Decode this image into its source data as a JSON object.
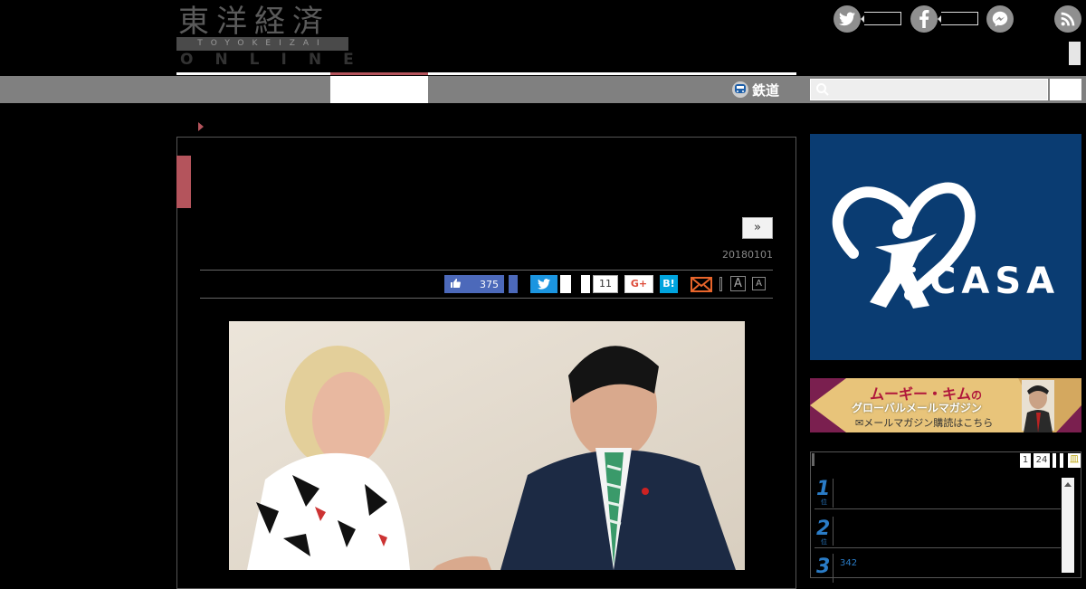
{
  "header": {
    "logo_kanji": "東洋経済",
    "logo_roman": "TOYOKEIZAI",
    "logo_online": "ONLINE",
    "social": [
      {
        "icon": "twitter-icon",
        "glyph": "t"
      },
      {
        "icon": "facebook-icon",
        "glyph": "f"
      },
      {
        "icon": "messenger-icon",
        "glyph": "~"
      },
      {
        "icon": "rss-icon",
        "glyph": ")"
      }
    ]
  },
  "nav": {
    "rail_label": "鉄道",
    "search_placeholder": ""
  },
  "article": {
    "next_label": "»",
    "date": "20180101",
    "share": {
      "like_count": "375",
      "hatena_count": "11",
      "gplus_label": "G+",
      "hatena_label": "B!",
      "font_large": "A",
      "font_small": "A"
    }
  },
  "sidebar": {
    "ad_casa_text": "CASA",
    "ad_muggy_title_main": "ムーギー・キム",
    "ad_muggy_title_no": "の",
    "ad_muggy_sub": "グローバルメールマガジン",
    "ad_muggy_cta": "✉メールマガジン購読はこちら",
    "ranking": {
      "tabs": [
        "1",
        "24",
        "",
        "",
        "皿"
      ],
      "items": [
        {
          "rank": "1",
          "suffix": "位"
        },
        {
          "rank": "2",
          "suffix": "位"
        },
        {
          "rank": "3",
          "suffix": "",
          "views": "342"
        }
      ]
    }
  },
  "colors": {
    "accent_red": "#b4545c",
    "nav_gray": "#808080",
    "facebook_blue": "#4c69ba",
    "twitter_blue": "#1b95e0",
    "hatena_blue": "#00a4de",
    "casa_navy": "#0a3c72",
    "rank_blue": "#2a7cc7"
  }
}
